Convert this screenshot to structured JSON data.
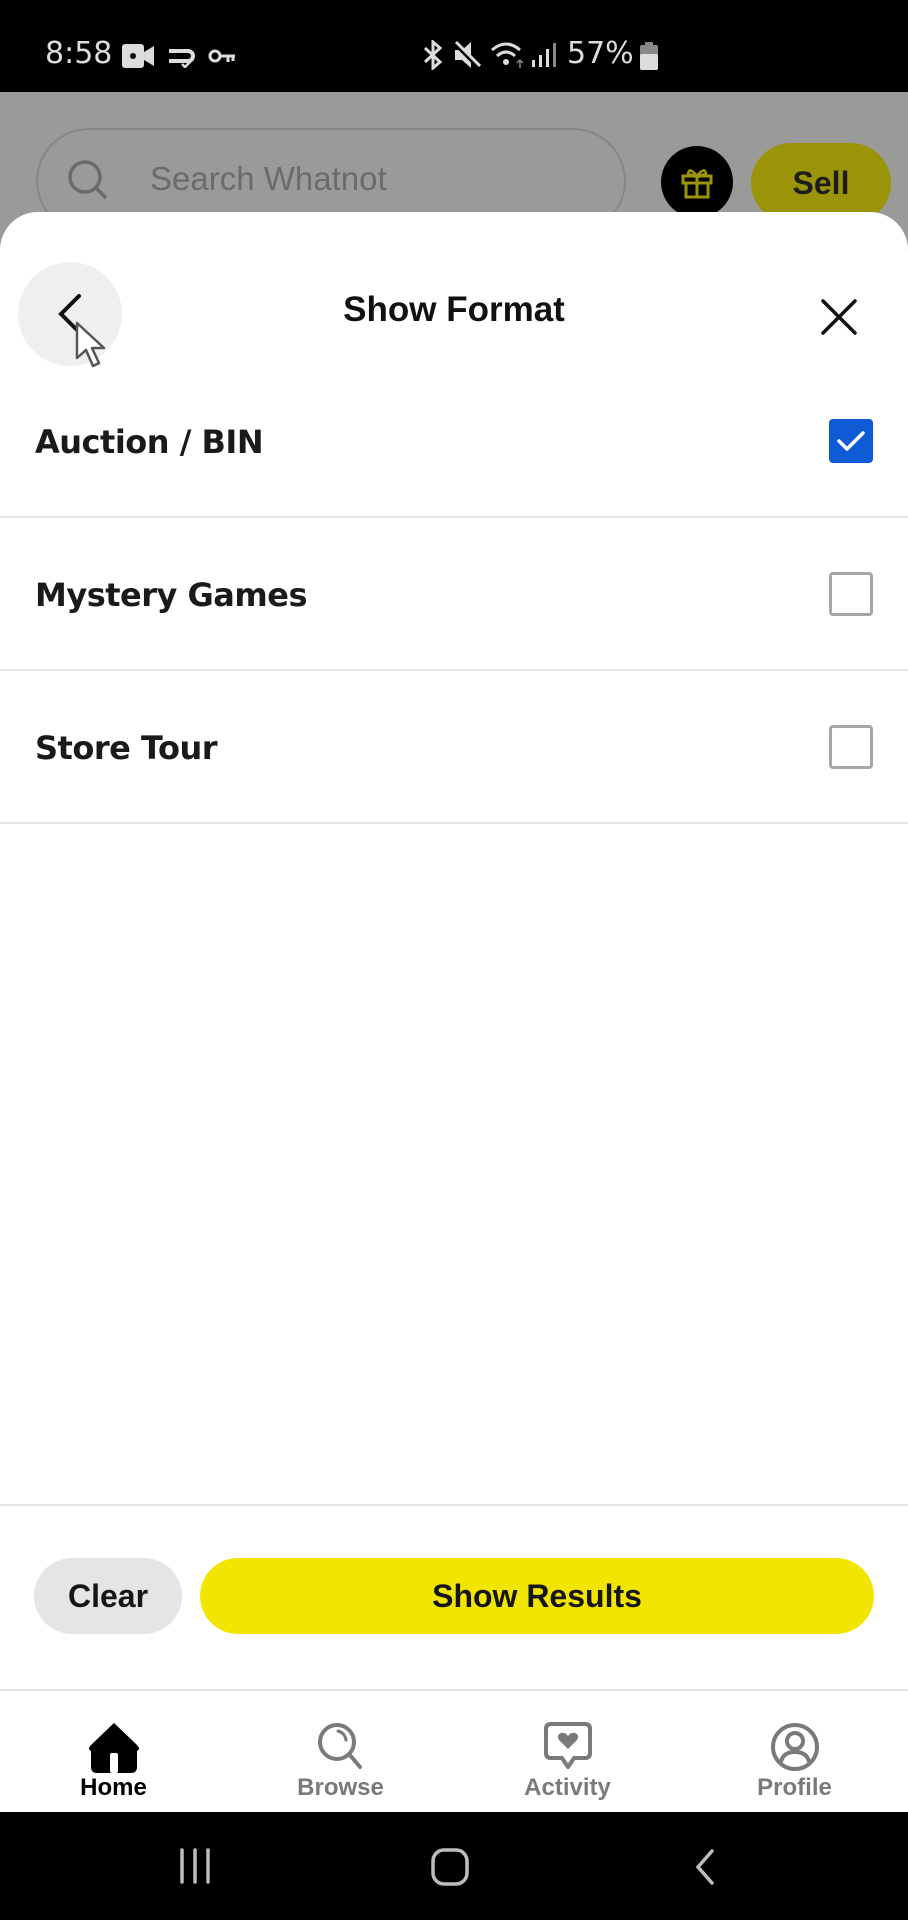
{
  "status_bar": {
    "time": "8:58",
    "battery": "57%",
    "left_icons": [
      "video-camera-icon",
      "sync-check-icon",
      "key-icon"
    ],
    "right_icons": [
      "bluetooth-icon",
      "mute-icon",
      "wifi-icon",
      "signal-icon",
      "battery-icon"
    ]
  },
  "background_app": {
    "search_placeholder": "Search Whatnot",
    "gift_icon": "gift-icon",
    "sell_label": "Sell"
  },
  "sheet": {
    "title": "Show Format",
    "back_icon": "chevron-left-icon",
    "close_icon": "close-icon",
    "options": [
      {
        "label": "Auction / BIN",
        "checked": true
      },
      {
        "label": "Mystery Games",
        "checked": false
      },
      {
        "label": "Store Tour",
        "checked": false
      }
    ],
    "clear_label": "Clear",
    "show_results_label": "Show Results"
  },
  "bottom_nav": {
    "items": [
      {
        "label": "Home",
        "icon": "home-icon",
        "active": true
      },
      {
        "label": "Browse",
        "icon": "browse-search-icon",
        "active": false
      },
      {
        "label": "Activity",
        "icon": "activity-heart-icon",
        "active": false
      },
      {
        "label": "Profile",
        "icon": "profile-icon",
        "active": false
      }
    ]
  },
  "colors": {
    "accent_yellow": "#f2e600",
    "checkbox_blue": "#0f5bd6",
    "dim_overlay": "#9a9b99"
  }
}
